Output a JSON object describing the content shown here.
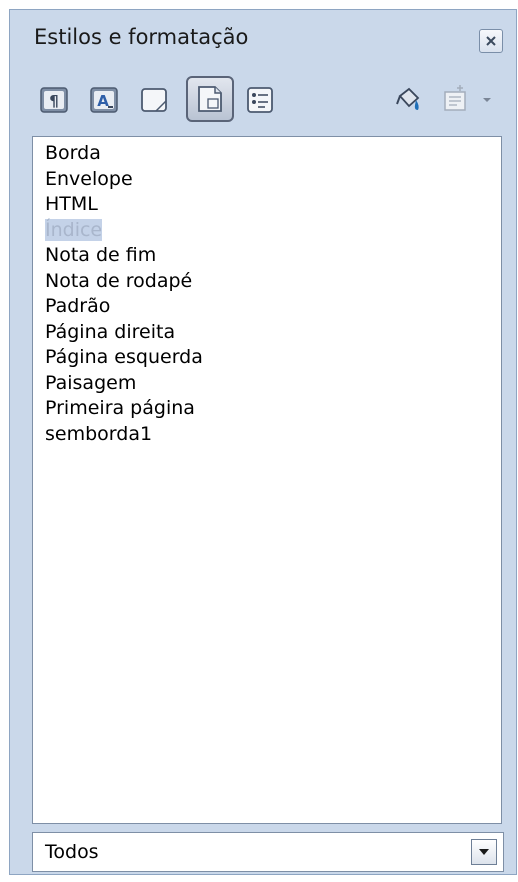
{
  "window": {
    "title": "Estilos e formatação"
  },
  "toolbar": {
    "buttons": [
      {
        "icon": "paragraph-styles-icon",
        "state": "normal"
      },
      {
        "icon": "character-styles-icon",
        "state": "normal"
      },
      {
        "icon": "frame-styles-icon",
        "state": "normal"
      },
      {
        "icon": "page-styles-icon",
        "state": "active"
      },
      {
        "icon": "list-styles-icon",
        "state": "normal"
      },
      {
        "icon": "fill-format-mode-icon",
        "state": "normal"
      },
      {
        "icon": "new-style-from-selection-icon",
        "state": "disabled"
      }
    ]
  },
  "styles_list": {
    "items": [
      {
        "label": "Borda"
      },
      {
        "label": "Envelope"
      },
      {
        "label": "HTML"
      },
      {
        "label": "Índice",
        "selected": true
      },
      {
        "label": "Nota de fim"
      },
      {
        "label": "Nota de rodapé"
      },
      {
        "label": "Padrão"
      },
      {
        "label": "Página direita"
      },
      {
        "label": "Página esquerda"
      },
      {
        "label": "Paisagem"
      },
      {
        "label": "Primeira página"
      },
      {
        "label": "semborda1"
      }
    ]
  },
  "filter": {
    "selected": "Todos"
  },
  "colors": {
    "panel_background": "#cad8ea",
    "selection_background": "#c4d2e8",
    "selection_text": "#a9b6cc"
  }
}
